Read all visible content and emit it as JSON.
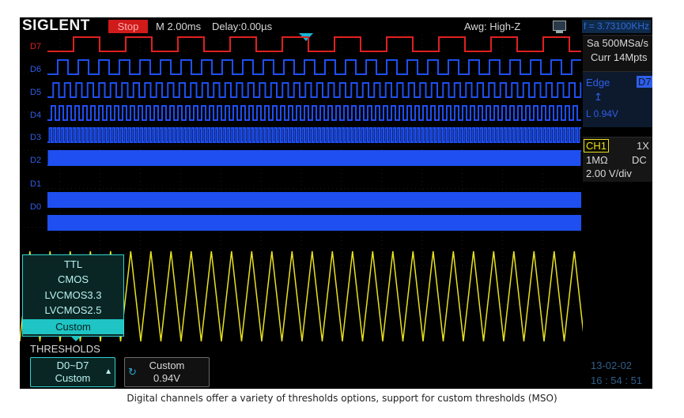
{
  "topbar": {
    "brand": "SIGLENT",
    "status": "Stop",
    "timebase": "M 2.00ms",
    "delay": "Delay:0.00µs",
    "awg": "Awg: High-Z",
    "frequency": "f = 3.73100KHz"
  },
  "channels": [
    {
      "label": "D7",
      "color": "#e02020"
    },
    {
      "label": "D6",
      "color": "#2f5fe8"
    },
    {
      "label": "D5",
      "color": "#2f5fe8"
    },
    {
      "label": "D4",
      "color": "#2f5fe8"
    },
    {
      "label": "D3",
      "color": "#2f5fe8"
    },
    {
      "label": "D2",
      "color": "#2f5fe8"
    },
    {
      "label": "D1",
      "color": "#2f5fe8"
    },
    {
      "label": "D0",
      "color": "#2f5fe8"
    }
  ],
  "colors": {
    "analog": "#e8e020",
    "digital": "#1f4ff0",
    "d7": "#e02020",
    "accent": "#1fc4c4"
  },
  "right_panel": {
    "sample_rate": "Sa 500MSa/s",
    "memory": "Curr 14Mpts",
    "trigger_type": "Edge",
    "trigger_source": "D7",
    "trigger_level": "L 0.94V",
    "channel": "CH1",
    "probe": "1X",
    "impedance": "1MΩ",
    "coupling": "DC",
    "scale": "2.00 V/div"
  },
  "threshold_menu": {
    "options": [
      "TTL",
      "CMOS",
      "LVCMOS3.3",
      "LVCMOS2.5",
      "Custom"
    ],
    "selected": "Custom"
  },
  "bottom": {
    "title": "THRESHOLDS",
    "group_line1": "D0~D7",
    "group_line2": "Custom",
    "value_line1": "Custom",
    "value_line2": "0.94V",
    "date": "13-02-02",
    "time": "16 : 54 : 51"
  },
  "caption": "Digital channels offer a variety of thresholds options, support for custom thresholds (MSO)"
}
